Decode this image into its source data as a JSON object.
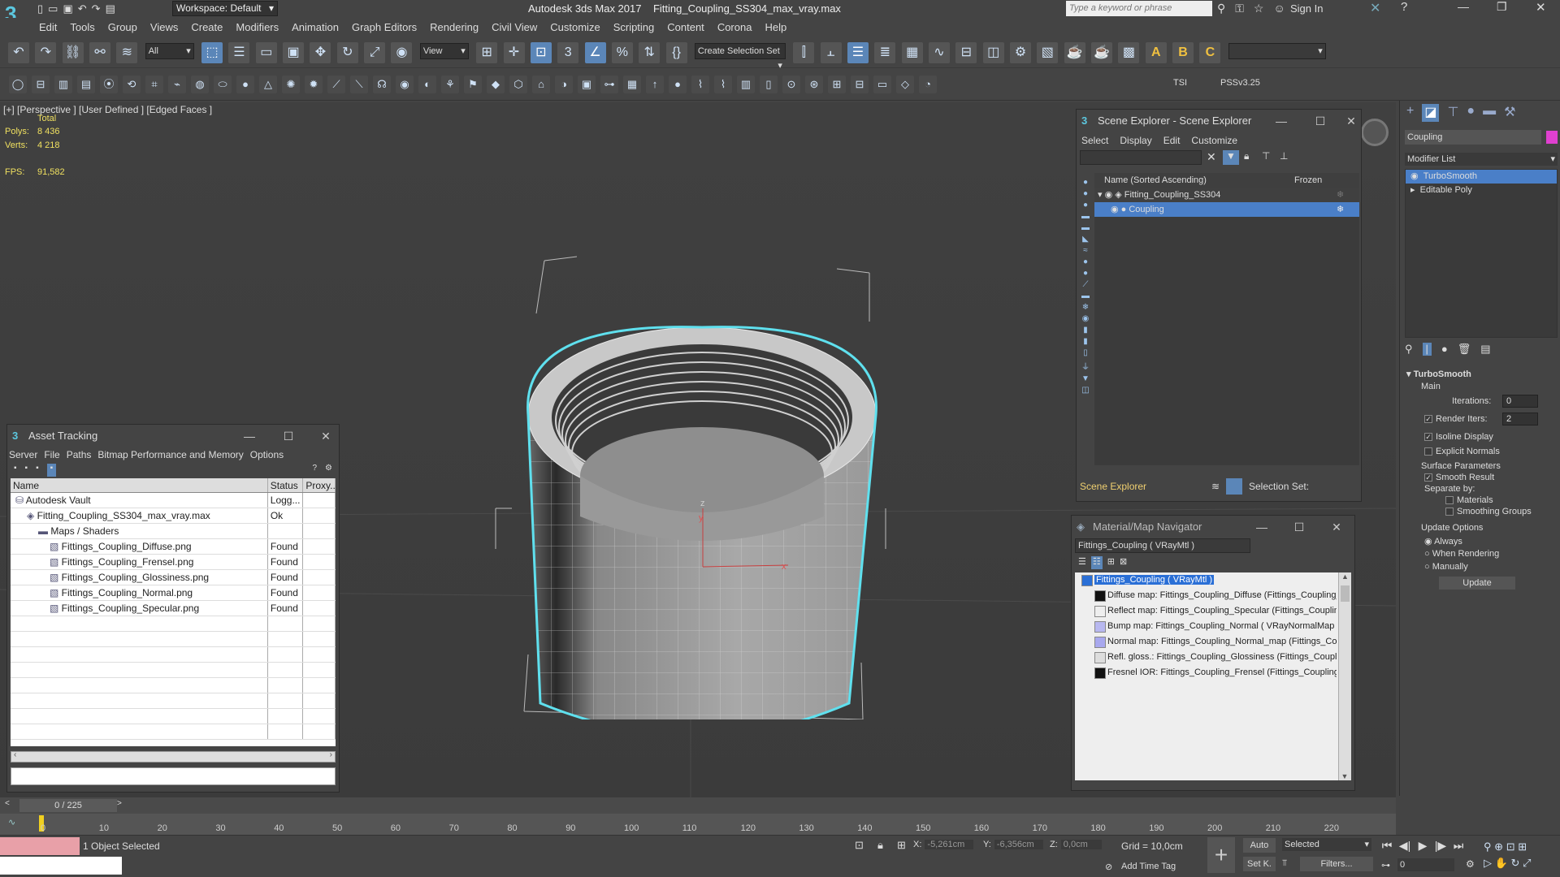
{
  "app": {
    "title": "Autodesk 3ds Max 2017",
    "file": "Fitting_Coupling_SS304_max_vray.max",
    "workspace": "Workspace: Default",
    "search_placeholder": "Type a keyword or phrase",
    "sign_in": "Sign In"
  },
  "menu": [
    "Edit",
    "Tools",
    "Group",
    "Views",
    "Create",
    "Modifiers",
    "Animation",
    "Graph Editors",
    "Rendering",
    "Civil View",
    "Customize",
    "Scripting",
    "Content",
    "Corona",
    "Help"
  ],
  "toolbar": {
    "filter": "All",
    "view": "View",
    "selection_set": "Create Selection Set"
  },
  "toolbar2": {
    "tsi": "TSI",
    "pss": "PSSv3.25"
  },
  "viewport": {
    "labels": "[+] [Perspective ] [User Defined ] [Edged Faces ]",
    "total": "Total",
    "polys_label": "Polys:",
    "polys": "8 436",
    "verts_label": "Verts:",
    "verts": "4 218",
    "fps_label": "FPS:",
    "fps": "91,582",
    "axis_x": "x",
    "axis_y": "y",
    "axis_z": "z"
  },
  "asset_tracking": {
    "title": "Asset Tracking",
    "menu": [
      "Server",
      "File",
      "Paths",
      "Bitmap Performance and Memory",
      "Options"
    ],
    "columns": [
      "Name",
      "Status",
      "Proxy..."
    ],
    "rows": [
      {
        "name": "Autodesk Vault",
        "status": "Logg...",
        "indent": 0
      },
      {
        "name": "Fitting_Coupling_SS304_max_vray.max",
        "status": "Ok",
        "indent": 1
      },
      {
        "name": "Maps / Shaders",
        "status": "",
        "indent": 2
      },
      {
        "name": "Fittings_Coupling_Diffuse.png",
        "status": "Found",
        "indent": 3
      },
      {
        "name": "Fittings_Coupling_Frensel.png",
        "status": "Found",
        "indent": 3
      },
      {
        "name": "Fittings_Coupling_Glossiness.png",
        "status": "Found",
        "indent": 3
      },
      {
        "name": "Fittings_Coupling_Normal.png",
        "status": "Found",
        "indent": 3
      },
      {
        "name": "Fittings_Coupling_Specular.png",
        "status": "Found",
        "indent": 3
      }
    ]
  },
  "scene_explorer": {
    "title": "Scene Explorer - Scene Explorer",
    "menu": [
      "Select",
      "Display",
      "Edit",
      "Customize"
    ],
    "col_name": "Name (Sorted Ascending)",
    "col_frozen": "Frozen",
    "items": [
      "Fitting_Coupling_SS304",
      "Coupling"
    ],
    "footer_label": "Scene Explorer",
    "selection_set": "Selection Set:"
  },
  "material_nav": {
    "title": "Material/Map Navigator",
    "material": "Fittings_Coupling  ( VRayMtl )",
    "rows": [
      {
        "text": "Fittings_Coupling  ( VRayMtl )",
        "color": "#2a6fd6"
      },
      {
        "text": "Diffuse map: Fittings_Coupling_Diffuse (Fittings_Coupling_Di",
        "color": "#111111"
      },
      {
        "text": "Reflect map: Fittings_Coupling_Specular (Fittings_Coupling_S",
        "color": "#eeeeee"
      },
      {
        "text": "Bump map: Fittings_Coupling_Normal  ( VRayNormalMap )",
        "color": "#b8b8f0"
      },
      {
        "text": "Normal map: Fittings_Coupling_Normal_map (Fittings_Coup",
        "color": "#a8a8ee"
      },
      {
        "text": "Refl. gloss.: Fittings_Coupling_Glossiness (Fittings_Coupling_(",
        "color": "#dddddd"
      },
      {
        "text": "Fresnel IOR: Fittings_Coupling_Frensel (Fittings_Coupling_Fr",
        "color": "#111111"
      }
    ]
  },
  "command_panel": {
    "object_name": "Coupling",
    "modifier_list": "Modifier List",
    "stack": [
      "TurboSmooth",
      "Editable Poly"
    ],
    "rollout": "TurboSmooth",
    "main": "Main",
    "iterations_label": "Iterations:",
    "iterations": "0",
    "render_iters_label": "Render Iters:",
    "render_iters": "2",
    "isoline": "Isoline Display",
    "explicit_normals": "Explicit Normals",
    "surface_params": "Surface Parameters",
    "smooth_result": "Smooth Result",
    "separate_by": "Separate by:",
    "materials": "Materials",
    "smoothing_groups": "Smoothing Groups",
    "update_options": "Update Options",
    "always": "Always",
    "when_rendering": "When Rendering",
    "manually": "Manually",
    "update_btn": "Update"
  },
  "timeline": {
    "frame": "0 / 225",
    "ticks": [
      "0",
      "10",
      "20",
      "30",
      "40",
      "50",
      "60",
      "70",
      "80",
      "90",
      "100",
      "110",
      "120",
      "130",
      "140",
      "150",
      "160",
      "170",
      "180",
      "190",
      "200",
      "210",
      "220"
    ]
  },
  "status": {
    "selected": "1 Object Selected",
    "x_label": "X:",
    "x": "-5,261cm",
    "y_label": "Y:",
    "y": "-6,356cm",
    "z_label": "Z:",
    "z": "0,0cm",
    "grid": "Grid = 10,0cm",
    "auto": "Auto",
    "selected_dd": "Selected",
    "set_k": "Set K.",
    "filters": "Filters...",
    "add_time_tag": "Add Time Tag",
    "frame_val": "0"
  },
  "colors": {
    "accent": "#5b86b8",
    "selection": "#4a7fc8",
    "cyan": "#5fe0ee"
  }
}
